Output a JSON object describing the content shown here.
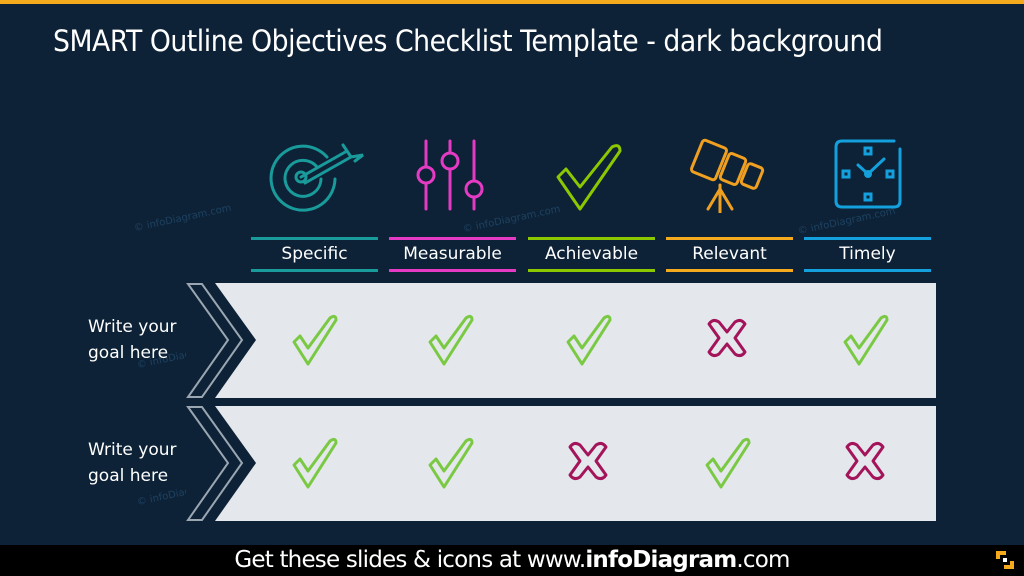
{
  "title": "SMART Outline Objectives Checklist Template - dark background",
  "accent_color": "#f5a91c",
  "columns": [
    {
      "label": "Specific",
      "icon": "target-arrow-icon",
      "color": "#1a9b9b"
    },
    {
      "label": "Measurable",
      "icon": "sliders-icon",
      "color": "#e53bc4"
    },
    {
      "label": "Achievable",
      "icon": "checkmark-icon",
      "color": "#8cc800"
    },
    {
      "label": "Relevant",
      "icon": "telescope-icon",
      "color": "#f0a020"
    },
    {
      "label": "Timely",
      "icon": "clock-icon",
      "color": "#14a0dc"
    }
  ],
  "rows": [
    {
      "goal": "Write your goal here",
      "goal_line1": "Write your",
      "goal_line2": "goal here",
      "status": [
        "check",
        "check",
        "check",
        "cross",
        "check"
      ]
    },
    {
      "goal": "Write your goal here",
      "goal_line1": "Write your",
      "goal_line2": "goal here",
      "status": [
        "check",
        "check",
        "cross",
        "check",
        "cross"
      ]
    }
  ],
  "status_colors": {
    "check": "#7ac943",
    "cross": "#a3145a"
  },
  "watermark": "© infoDiagram.com",
  "footer": {
    "prefix": "Get these slides & icons at www.",
    "brand": "infoDiagram",
    "suffix": ".com"
  }
}
